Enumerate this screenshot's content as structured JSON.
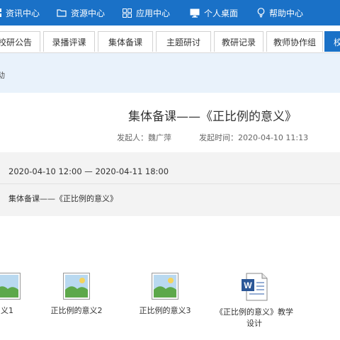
{
  "topnav": {
    "items": [
      {
        "label": "资讯中心",
        "icon": "grid-icon"
      },
      {
        "label": "资源中心",
        "icon": "folder-icon"
      },
      {
        "label": "应用中心",
        "icon": "apps-icon"
      },
      {
        "label": "个人桌面",
        "icon": "monitor-icon"
      },
      {
        "label": "帮助中心",
        "icon": "lightbulb-icon"
      }
    ]
  },
  "tabs": [
    {
      "label": "校研公告"
    },
    {
      "label": "录播评课"
    },
    {
      "label": "集体备课"
    },
    {
      "label": "主题研讨"
    },
    {
      "label": "教研记录"
    },
    {
      "label": "教师协作组"
    },
    {
      "label": "校"
    }
  ],
  "breadcrumb": "动",
  "post": {
    "title": "集体备课——《正比例的意义》",
    "author": "发起人：魏广萍",
    "published": "发起时间：2020-04-10 11:13",
    "time_range": "2020-04-10 12:00 — 2020-04-11 18:00",
    "subject": "集体备课——《正比例的意义》"
  },
  "files": [
    {
      "label": "义1",
      "icon": "image-file-icon"
    },
    {
      "label": "正比例的意义2",
      "icon": "image-file-icon"
    },
    {
      "label": "正比例的意义3",
      "icon": "image-file-icon"
    },
    {
      "label": "《正比例的意义》教学设计",
      "icon": "word-file-icon"
    }
  ],
  "colors": {
    "brand": "#1a71c7",
    "panel": "#e9f2fb",
    "box": "#f3f3f3"
  }
}
